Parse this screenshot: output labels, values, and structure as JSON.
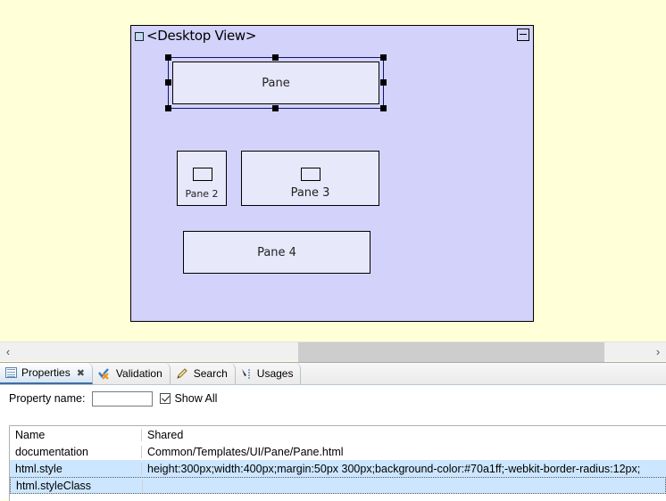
{
  "editor": {
    "background_color": "#ffffd8",
    "desktop_view": {
      "title": "<Desktop View>",
      "background_color": "#d3d2fb",
      "minimize_label": "",
      "panes": [
        {
          "label": "Pane",
          "selected": true,
          "has_inner_box": false
        },
        {
          "label": "Pane 2",
          "selected": false,
          "has_inner_box": true
        },
        {
          "label": "Pane 3",
          "selected": false,
          "has_inner_box": true
        },
        {
          "label": "Pane 4",
          "selected": false,
          "has_inner_box": false
        }
      ]
    },
    "scrollbar": {
      "left_arrow": "‹",
      "right_arrow": "›"
    }
  },
  "bottom_panel": {
    "tabs": [
      {
        "label": "Properties",
        "icon": "properties-icon",
        "active": true,
        "closable": true,
        "close_glyph": "✖"
      },
      {
        "label": "Validation",
        "icon": "validation-icon",
        "active": false,
        "closable": false,
        "close_glyph": ""
      },
      {
        "label": "Search",
        "icon": "search-icon",
        "active": false,
        "closable": false,
        "close_glyph": ""
      },
      {
        "label": "Usages",
        "icon": "usages-icon",
        "active": false,
        "closable": false,
        "close_glyph": ""
      }
    ],
    "filter": {
      "property_name_label": "Property name:",
      "property_name_value": "",
      "property_name_placeholder": "",
      "show_all_label": "Show All",
      "show_all_checked": true
    },
    "table": {
      "columns": [
        "Name",
        "Shared"
      ],
      "rows": [
        {
          "name": "documentation",
          "value": "Common/Templates/UI/Pane/Pane.html",
          "selected": false,
          "focused": false
        },
        {
          "name": "html.style",
          "value": "height:300px;width:400px;margin:50px 300px;background-color:#70a1ff;-webkit-border-radius:12px;",
          "selected": true,
          "focused": false
        },
        {
          "name": "html.styleClass",
          "value": "",
          "selected": true,
          "focused": true
        }
      ]
    }
  },
  "colors": {
    "canvas_background": "#ffffd8",
    "desktop_background": "#d3d2fb",
    "pane_fill": "#e8e8fb",
    "selection_row": "#cce6ff",
    "tab_active": "#d6e4f2"
  }
}
